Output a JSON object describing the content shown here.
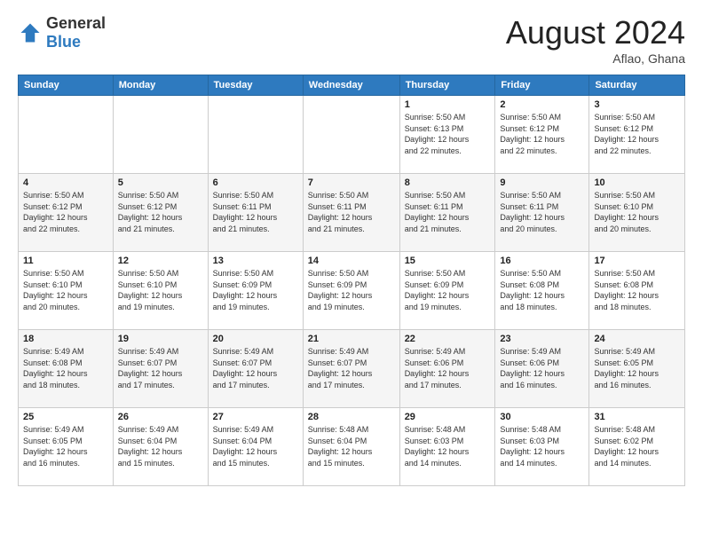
{
  "header": {
    "logo_general": "General",
    "logo_blue": "Blue",
    "month_title": "August 2024",
    "location": "Aflao, Ghana"
  },
  "weekdays": [
    "Sunday",
    "Monday",
    "Tuesday",
    "Wednesday",
    "Thursday",
    "Friday",
    "Saturday"
  ],
  "weeks": [
    [
      {
        "day": "",
        "info": ""
      },
      {
        "day": "",
        "info": ""
      },
      {
        "day": "",
        "info": ""
      },
      {
        "day": "",
        "info": ""
      },
      {
        "day": "1",
        "info": "Sunrise: 5:50 AM\nSunset: 6:13 PM\nDaylight: 12 hours\nand 22 minutes."
      },
      {
        "day": "2",
        "info": "Sunrise: 5:50 AM\nSunset: 6:12 PM\nDaylight: 12 hours\nand 22 minutes."
      },
      {
        "day": "3",
        "info": "Sunrise: 5:50 AM\nSunset: 6:12 PM\nDaylight: 12 hours\nand 22 minutes."
      }
    ],
    [
      {
        "day": "4",
        "info": "Sunrise: 5:50 AM\nSunset: 6:12 PM\nDaylight: 12 hours\nand 22 minutes."
      },
      {
        "day": "5",
        "info": "Sunrise: 5:50 AM\nSunset: 6:12 PM\nDaylight: 12 hours\nand 21 minutes."
      },
      {
        "day": "6",
        "info": "Sunrise: 5:50 AM\nSunset: 6:11 PM\nDaylight: 12 hours\nand 21 minutes."
      },
      {
        "day": "7",
        "info": "Sunrise: 5:50 AM\nSunset: 6:11 PM\nDaylight: 12 hours\nand 21 minutes."
      },
      {
        "day": "8",
        "info": "Sunrise: 5:50 AM\nSunset: 6:11 PM\nDaylight: 12 hours\nand 21 minutes."
      },
      {
        "day": "9",
        "info": "Sunrise: 5:50 AM\nSunset: 6:11 PM\nDaylight: 12 hours\nand 20 minutes."
      },
      {
        "day": "10",
        "info": "Sunrise: 5:50 AM\nSunset: 6:10 PM\nDaylight: 12 hours\nand 20 minutes."
      }
    ],
    [
      {
        "day": "11",
        "info": "Sunrise: 5:50 AM\nSunset: 6:10 PM\nDaylight: 12 hours\nand 20 minutes."
      },
      {
        "day": "12",
        "info": "Sunrise: 5:50 AM\nSunset: 6:10 PM\nDaylight: 12 hours\nand 19 minutes."
      },
      {
        "day": "13",
        "info": "Sunrise: 5:50 AM\nSunset: 6:09 PM\nDaylight: 12 hours\nand 19 minutes."
      },
      {
        "day": "14",
        "info": "Sunrise: 5:50 AM\nSunset: 6:09 PM\nDaylight: 12 hours\nand 19 minutes."
      },
      {
        "day": "15",
        "info": "Sunrise: 5:50 AM\nSunset: 6:09 PM\nDaylight: 12 hours\nand 19 minutes."
      },
      {
        "day": "16",
        "info": "Sunrise: 5:50 AM\nSunset: 6:08 PM\nDaylight: 12 hours\nand 18 minutes."
      },
      {
        "day": "17",
        "info": "Sunrise: 5:50 AM\nSunset: 6:08 PM\nDaylight: 12 hours\nand 18 minutes."
      }
    ],
    [
      {
        "day": "18",
        "info": "Sunrise: 5:49 AM\nSunset: 6:08 PM\nDaylight: 12 hours\nand 18 minutes."
      },
      {
        "day": "19",
        "info": "Sunrise: 5:49 AM\nSunset: 6:07 PM\nDaylight: 12 hours\nand 17 minutes."
      },
      {
        "day": "20",
        "info": "Sunrise: 5:49 AM\nSunset: 6:07 PM\nDaylight: 12 hours\nand 17 minutes."
      },
      {
        "day": "21",
        "info": "Sunrise: 5:49 AM\nSunset: 6:07 PM\nDaylight: 12 hours\nand 17 minutes."
      },
      {
        "day": "22",
        "info": "Sunrise: 5:49 AM\nSunset: 6:06 PM\nDaylight: 12 hours\nand 17 minutes."
      },
      {
        "day": "23",
        "info": "Sunrise: 5:49 AM\nSunset: 6:06 PM\nDaylight: 12 hours\nand 16 minutes."
      },
      {
        "day": "24",
        "info": "Sunrise: 5:49 AM\nSunset: 6:05 PM\nDaylight: 12 hours\nand 16 minutes."
      }
    ],
    [
      {
        "day": "25",
        "info": "Sunrise: 5:49 AM\nSunset: 6:05 PM\nDaylight: 12 hours\nand 16 minutes."
      },
      {
        "day": "26",
        "info": "Sunrise: 5:49 AM\nSunset: 6:04 PM\nDaylight: 12 hours\nand 15 minutes."
      },
      {
        "day": "27",
        "info": "Sunrise: 5:49 AM\nSunset: 6:04 PM\nDaylight: 12 hours\nand 15 minutes."
      },
      {
        "day": "28",
        "info": "Sunrise: 5:48 AM\nSunset: 6:04 PM\nDaylight: 12 hours\nand 15 minutes."
      },
      {
        "day": "29",
        "info": "Sunrise: 5:48 AM\nSunset: 6:03 PM\nDaylight: 12 hours\nand 14 minutes."
      },
      {
        "day": "30",
        "info": "Sunrise: 5:48 AM\nSunset: 6:03 PM\nDaylight: 12 hours\nand 14 minutes."
      },
      {
        "day": "31",
        "info": "Sunrise: 5:48 AM\nSunset: 6:02 PM\nDaylight: 12 hours\nand 14 minutes."
      }
    ]
  ]
}
